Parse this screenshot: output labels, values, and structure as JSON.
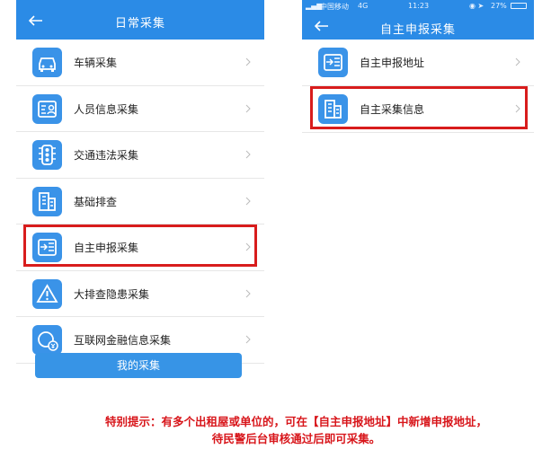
{
  "left": {
    "title": "日常采集",
    "items": [
      {
        "label": "车辆采集",
        "icon": "car-icon"
      },
      {
        "label": "人员信息采集",
        "icon": "id-card-icon"
      },
      {
        "label": "交通违法采集",
        "icon": "traffic-light-icon"
      },
      {
        "label": "基础排查",
        "icon": "building-icon"
      },
      {
        "label": "自主申报采集",
        "icon": "report-icon"
      },
      {
        "label": "大排查隐患采集",
        "icon": "warning-icon"
      },
      {
        "label": "互联网金融信息采集",
        "icon": "finance-icon"
      }
    ],
    "my_button": "我的采集"
  },
  "right": {
    "status": {
      "carrier": "中国移动",
      "network": "4G",
      "time": "11:23",
      "battery": "27%"
    },
    "title": "自主申报采集",
    "items": [
      {
        "label": "自主申报地址",
        "icon": "report-icon"
      },
      {
        "label": "自主采集信息",
        "icon": "building-icon"
      }
    ]
  },
  "note": {
    "line1": "特别提示：有多个出租屋或单位的，可在【自主申报地址】中新增申报地址，",
    "line2": "待民警后台审核通过后即可采集。"
  },
  "colors": {
    "primary": "#2b8be6",
    "highlight": "#d81c1c",
    "note": "#d8161b"
  }
}
